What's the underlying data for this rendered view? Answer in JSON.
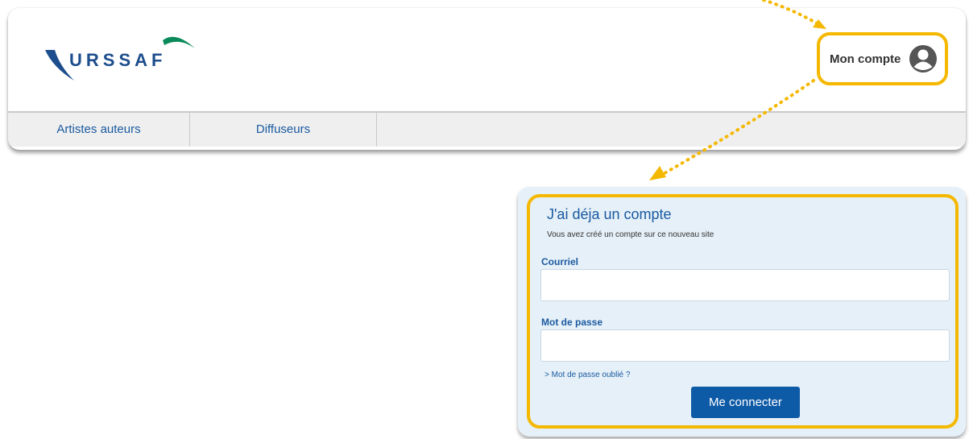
{
  "header": {
    "logo_text": "URSSAF",
    "account_label": "Mon compte"
  },
  "nav": {
    "items": [
      {
        "label": "Artistes auteurs"
      },
      {
        "label": "Diffuseurs"
      }
    ]
  },
  "login": {
    "title": "J'ai déja un compte",
    "subtitle": "Vous avez créé un compte sur ce nouveau site",
    "email_label": "Courriel",
    "password_label": "Mot de passe",
    "forgot_link": "> Mot de passe oublié ?",
    "submit_label": "Me connecter"
  },
  "colors": {
    "highlight": "#f5b800",
    "brand_blue": "#1a5aa0",
    "button_blue": "#0d5aa7",
    "panel_bg": "#e6f0f8"
  }
}
